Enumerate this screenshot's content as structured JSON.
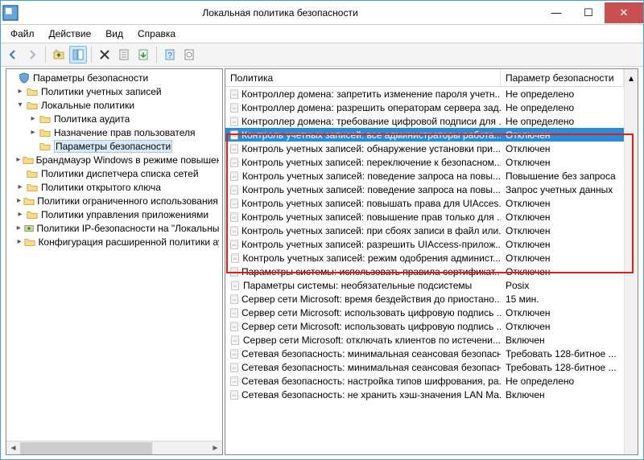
{
  "window": {
    "title": "Локальная политика безопасности"
  },
  "menubar": [
    "Файл",
    "Действие",
    "Вид",
    "Справка"
  ],
  "tree": {
    "header": "Параметры безопасности",
    "nodes": [
      {
        "depth": 0,
        "expand": "▸",
        "icon": "folder",
        "label": "Политики учетных записей"
      },
      {
        "depth": 0,
        "expand": "▾",
        "icon": "folder",
        "label": "Локальные политики"
      },
      {
        "depth": 1,
        "expand": "▸",
        "icon": "folder",
        "label": "Политика аудита"
      },
      {
        "depth": 1,
        "expand": "▸",
        "icon": "folder",
        "label": "Назначение прав пользователя"
      },
      {
        "depth": 1,
        "expand": "",
        "icon": "folder",
        "label": "Параметры безопасности",
        "selected": true
      },
      {
        "depth": 0,
        "expand": "▸",
        "icon": "folder",
        "label": "Брандмауэр Windows в режиме повышенной безопасности"
      },
      {
        "depth": 0,
        "expand": "",
        "icon": "folder",
        "label": "Политики диспетчера списка сетей"
      },
      {
        "depth": 0,
        "expand": "▸",
        "icon": "folder",
        "label": "Политики открытого ключа"
      },
      {
        "depth": 0,
        "expand": "▸",
        "icon": "folder",
        "label": "Политики ограниченного использования программ"
      },
      {
        "depth": 0,
        "expand": "▸",
        "icon": "folder",
        "label": "Политики управления приложениями"
      },
      {
        "depth": 0,
        "expand": "▸",
        "icon": "ipsec",
        "label": "Политики IP-безопасности на \"Локальный компьютер\""
      },
      {
        "depth": 0,
        "expand": "▸",
        "icon": "folder",
        "label": "Конфигурация расширенной политики аудита"
      }
    ]
  },
  "list": {
    "columns": [
      "Политика",
      "Параметр безопасности"
    ],
    "rows": [
      {
        "policy": "Контроллер домена: запретить изменение пароля учетн...",
        "value": "Не определено"
      },
      {
        "policy": "Контроллер домена: разрешить операторам сервера зад...",
        "value": "Не определено"
      },
      {
        "policy": "Контроллер домена: требование цифровой подписи для ...",
        "value": "Не определено"
      },
      {
        "policy": "Контроль учетных записей: все администраторы работа...",
        "value": "Отключен",
        "selected": true
      },
      {
        "policy": "Контроль учетных записей: обнаружение установки при...",
        "value": "Отключен"
      },
      {
        "policy": "Контроль учетных записей: переключение к безопасном...",
        "value": "Отключен"
      },
      {
        "policy": "Контроль учетных записей: поведение запроса на повы...",
        "value": "Повышение без запроса"
      },
      {
        "policy": "Контроль учетных записей: поведение запроса на повы...",
        "value": "Запрос учетных данных"
      },
      {
        "policy": "Контроль учетных записей: повышать права для UIAcces...",
        "value": "Отключен"
      },
      {
        "policy": "Контроль учетных записей: повышение прав только для ...",
        "value": "Отключен"
      },
      {
        "policy": "Контроль учетных записей: при сбоях записи в файл или...",
        "value": "Отключен"
      },
      {
        "policy": "Контроль учетных записей: разрешить UIAccess-прилож...",
        "value": "Отключен"
      },
      {
        "policy": "Контроль учетных записей: режим одобрения админист...",
        "value": "Отключен"
      },
      {
        "policy": "Параметры системы: использовать правила сертификат...",
        "value": "Отключен"
      },
      {
        "policy": "Параметры системы: необязательные подсистемы",
        "value": "Posix"
      },
      {
        "policy": "Сервер сети Microsoft: время бездействия до приостано...",
        "value": "15 мин."
      },
      {
        "policy": "Сервер сети Microsoft: использовать цифровую подпись ...",
        "value": "Отключен"
      },
      {
        "policy": "Сервер сети Microsoft: использовать цифровую подпись ...",
        "value": "Отключен"
      },
      {
        "policy": "Сервер сети Microsoft: отключать клиентов по истечени...",
        "value": "Включен"
      },
      {
        "policy": "Сетевая безопасность: минимальная сеансовая безопасн...",
        "value": "Требовать 128-битное ..."
      },
      {
        "policy": "Сетевая безопасность: минимальная сеансовая безопасн...",
        "value": "Требовать 128-битное ..."
      },
      {
        "policy": "Сетевая безопасность: настройка типов шифрования, ра...",
        "value": "Не определено"
      },
      {
        "policy": "Сетевая безопасность: не хранить хэш-значения LAN Ma...",
        "value": "Включен"
      }
    ]
  }
}
